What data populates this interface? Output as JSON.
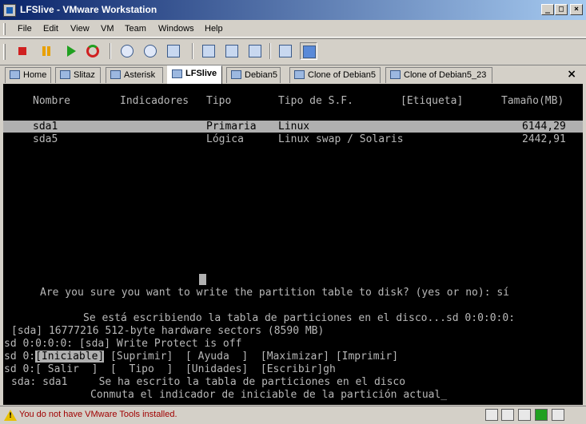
{
  "window": {
    "title": "LFSlive - VMware Workstation",
    "controls": [
      "_",
      "□",
      "×"
    ]
  },
  "menu": [
    "File",
    "Edit",
    "View",
    "VM",
    "Team",
    "Windows",
    "Help"
  ],
  "tabs": [
    {
      "label": "Home",
      "active": false
    },
    {
      "label": "Slitaz",
      "active": false
    },
    {
      "label": "Asterisk",
      "active": false
    },
    {
      "label": "LFSlive",
      "active": true
    },
    {
      "label": "Debian5",
      "active": false
    },
    {
      "label": "Clone of Debian5",
      "active": false
    },
    {
      "label": "Clone of Debian5_23",
      "active": false
    }
  ],
  "tab_close": "×",
  "console": {
    "headers": {
      "nombre": "Nombre",
      "indicadores": "Indicadores",
      "tipo": "Tipo",
      "tipo_sf": "Tipo de S.F.",
      "etiqueta": "[Etiqueta]",
      "tamano": "Tamaño(MB)"
    },
    "partitions": [
      {
        "nombre": "sda1",
        "tipo": "Primaria",
        "tipo_sf": "Linux",
        "tamano": "6144,29"
      },
      {
        "nombre": "sda5",
        "tipo": "Lógica",
        "tipo_sf": "Linux swap / Solaris",
        "tamano": "2442,91"
      }
    ],
    "prompt": "Are you sure you want to write the partition table to disk? (yes or no): sí",
    "writing": "Se está escribiendo la tabla de particiones en el disco...sd 0:0:0:0:",
    "log1": "[sda] 16777216 512-byte hardware sectors (8590 MB)",
    "log2": "sd 0:0:0:0: [sda] Write Protect is off",
    "menu_line1_prefix": "sd 0:",
    "btn_iniciable": "[Iniciable]",
    "menu_line1_rest": " [Suprimir]  [ Ayuda  ]  [Maximizar] [Imprimir]",
    "menu_line2": "sd 0:[ Salir  ]  [  Tipo  ]  [Unidades]  [Escribir]gh",
    "written": "sda: sda1     Se ha escrito la tabla de particiones en el disco",
    "help": "Conmuta el indicador de iniciable de la partición actual_"
  },
  "status": {
    "message": "You do not have VMware Tools installed."
  }
}
